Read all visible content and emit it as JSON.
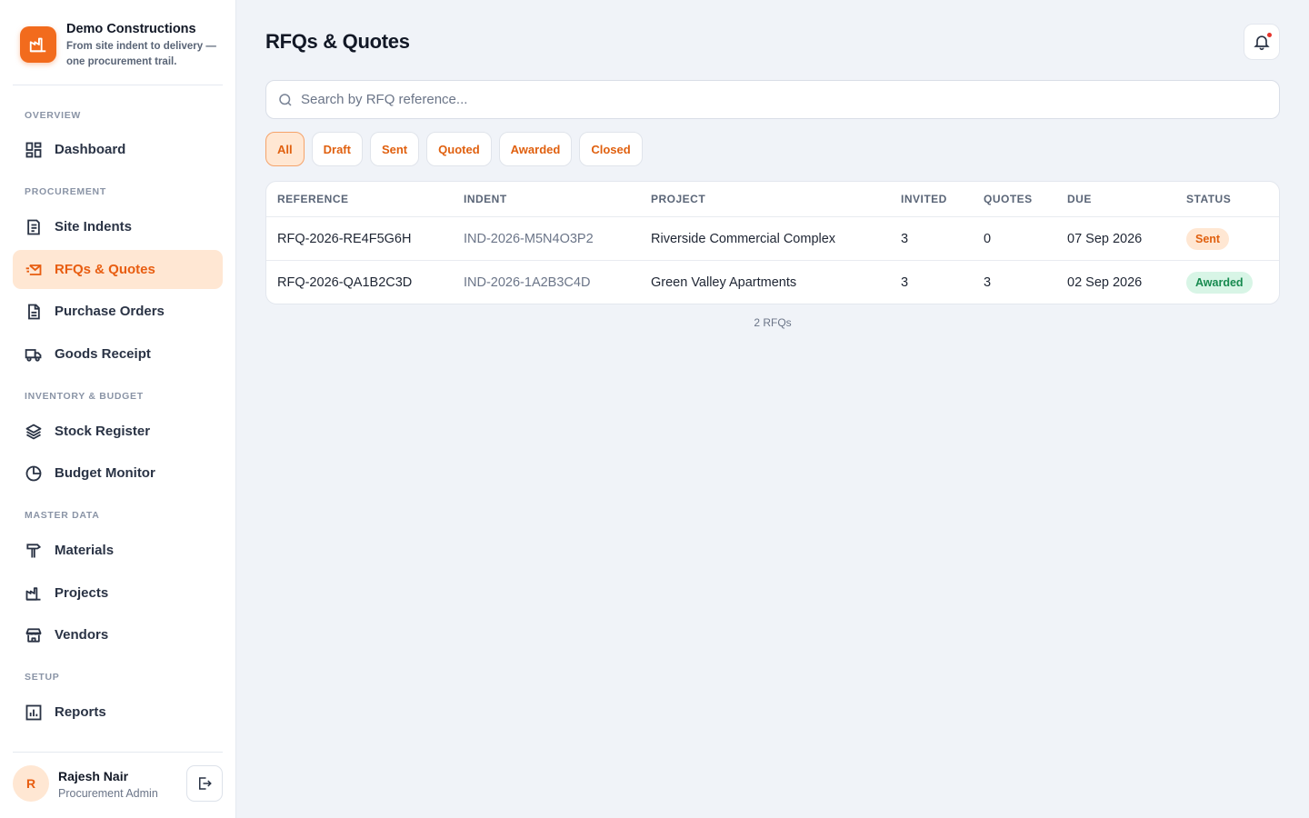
{
  "brand": {
    "name": "Demo Constructions",
    "tagline": "From site indent to delivery — one procurement trail."
  },
  "sidebar": {
    "sections": [
      {
        "label": "OVERVIEW",
        "items": [
          {
            "label": "Dashboard",
            "icon": "dashboard-icon"
          }
        ]
      },
      {
        "label": "PROCUREMENT",
        "items": [
          {
            "label": "Site Indents",
            "icon": "clipboard-list-icon"
          },
          {
            "label": "RFQs & Quotes",
            "icon": "mail-send-icon",
            "active": true
          },
          {
            "label": "Purchase Orders",
            "icon": "document-icon"
          },
          {
            "label": "Goods Receipt",
            "icon": "truck-icon"
          }
        ]
      },
      {
        "label": "INVENTORY & BUDGET",
        "items": [
          {
            "label": "Stock Register",
            "icon": "layers-icon"
          },
          {
            "label": "Budget Monitor",
            "icon": "pie-chart-icon"
          }
        ]
      },
      {
        "label": "MASTER DATA",
        "items": [
          {
            "label": "Materials",
            "icon": "hammer-icon"
          },
          {
            "label": "Projects",
            "icon": "factory-icon"
          },
          {
            "label": "Vendors",
            "icon": "store-icon"
          }
        ]
      },
      {
        "label": "SETUP",
        "items": [
          {
            "label": "Reports",
            "icon": "bar-chart-icon"
          }
        ]
      }
    ]
  },
  "user": {
    "initial": "R",
    "name": "Rajesh Nair",
    "role": "Procurement Admin"
  },
  "header": {
    "title": "RFQs & Quotes",
    "notification_icon": "bell-icon",
    "has_unread": true
  },
  "search": {
    "placeholder": "Search by RFQ reference...",
    "value": ""
  },
  "filters": {
    "options": [
      "All",
      "Draft",
      "Sent",
      "Quoted",
      "Awarded",
      "Closed"
    ],
    "selected": "All"
  },
  "table": {
    "columns": [
      "REFERENCE",
      "INDENT",
      "PROJECT",
      "INVITED",
      "QUOTES",
      "DUE",
      "STATUS"
    ],
    "rows": [
      {
        "reference": "RFQ-2026-RE4F5G6H",
        "indent": "IND-2026-M5N4O3P2",
        "project": "Riverside Commercial Complex",
        "invited": "3",
        "quotes": "0",
        "due": "07 Sep 2026",
        "status": "Sent"
      },
      {
        "reference": "RFQ-2026-QA1B2C3D",
        "indent": "IND-2026-1A2B3C4D",
        "project": "Green Valley Apartments",
        "invited": "3",
        "quotes": "3",
        "due": "02 Sep 2026",
        "status": "Awarded"
      }
    ],
    "count_label": "2 RFQs"
  },
  "colors": {
    "accent": "#f26b1d",
    "accent_soft": "#ffe7d3",
    "success": "#178a4f",
    "success_soft": "#d8f5e6",
    "danger": "#e5342c"
  }
}
